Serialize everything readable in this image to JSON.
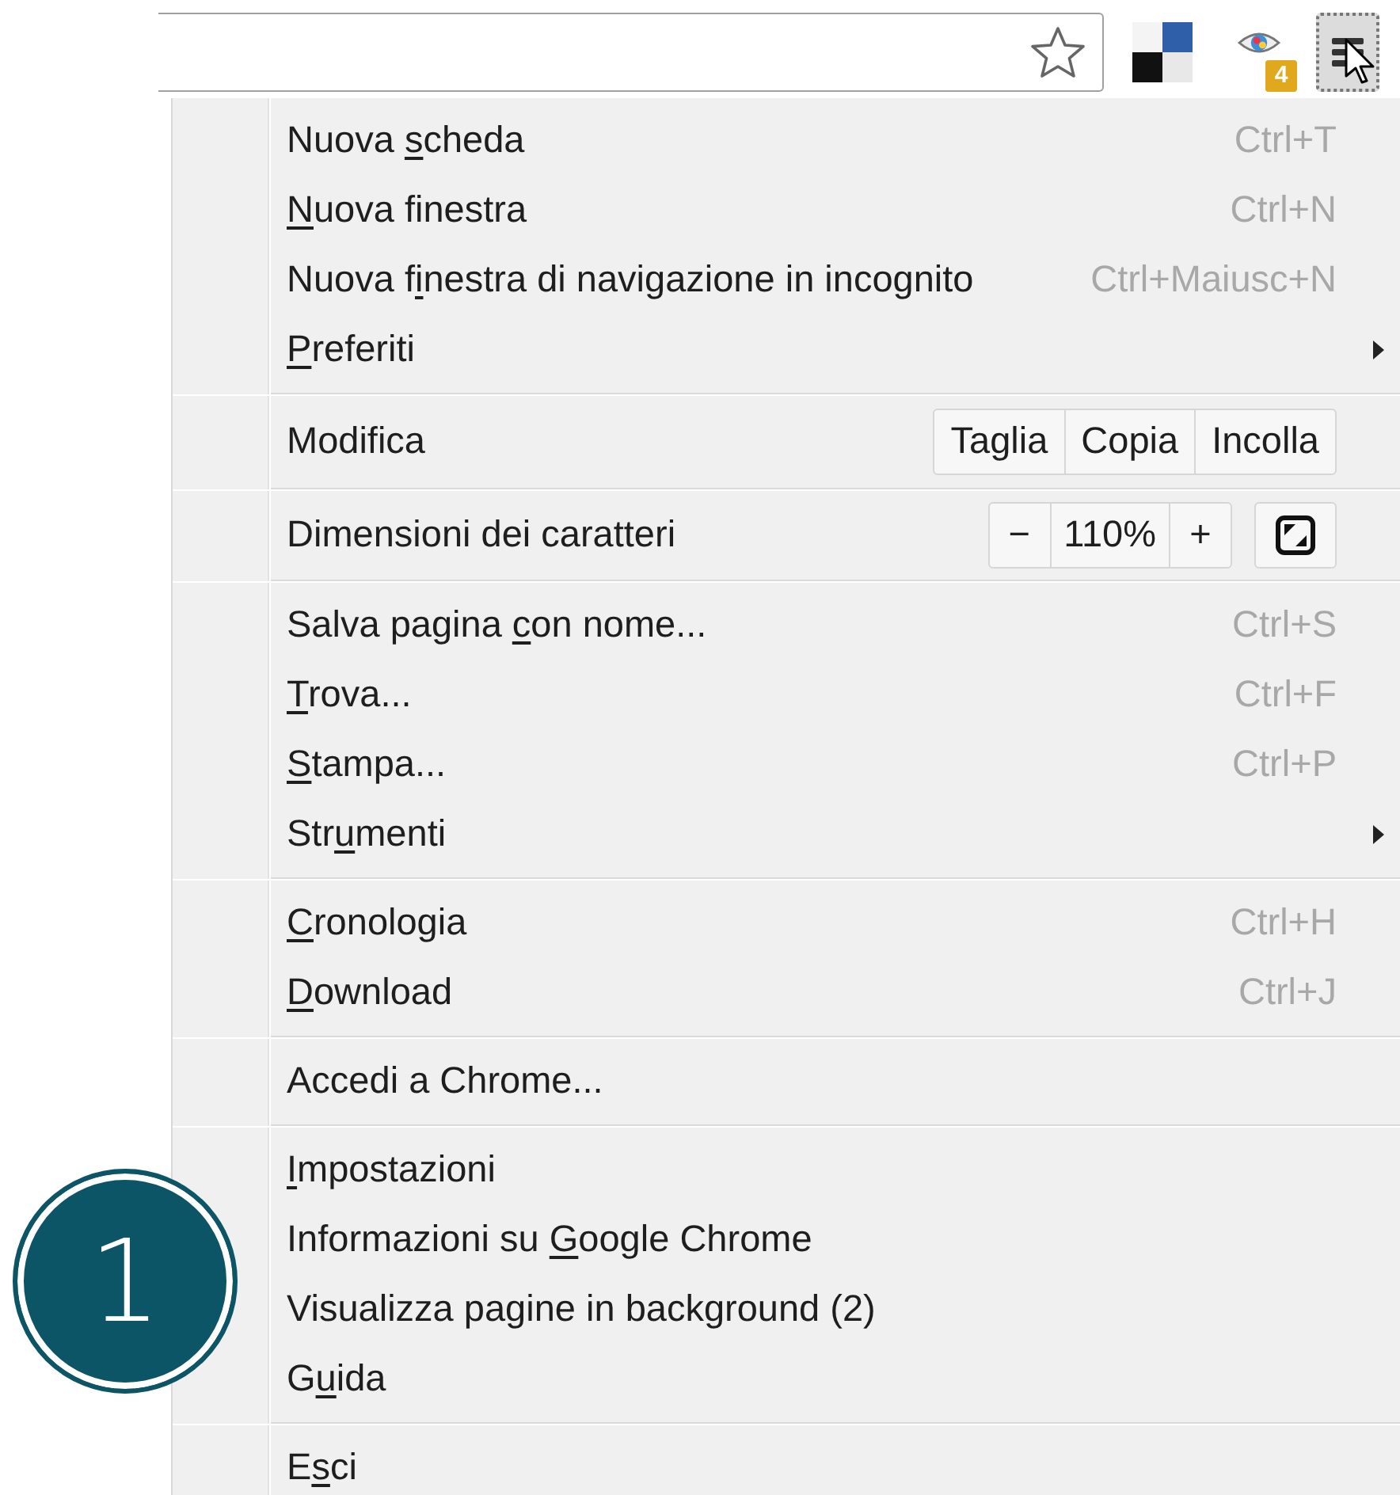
{
  "toolbar": {
    "extension_badge": "4"
  },
  "menu": {
    "sections": [
      {
        "items": [
          {
            "kind": "command",
            "label_parts": [
              {
                "text": "Nuova ",
                "underlined": false
              },
              {
                "text": "s",
                "underlined": true
              },
              {
                "text": "cheda",
                "underlined": false
              }
            ],
            "shortcut": "Ctrl+T"
          },
          {
            "kind": "command",
            "label_parts": [
              {
                "text": "N",
                "underlined": true
              },
              {
                "text": "uova finestra",
                "underlined": false
              }
            ],
            "shortcut": "Ctrl+N"
          },
          {
            "kind": "command",
            "label_parts": [
              {
                "text": "Nuova f",
                "underlined": false
              },
              {
                "text": "i",
                "underlined": true
              },
              {
                "text": "nestra di navigazione in incognito",
                "underlined": false
              }
            ],
            "shortcut": "Ctrl+Maiusc+N"
          },
          {
            "kind": "submenu",
            "label_parts": [
              {
                "text": "P",
                "underlined": true
              },
              {
                "text": "referiti",
                "underlined": false
              }
            ]
          }
        ]
      },
      {
        "items": [
          {
            "kind": "edit",
            "label_parts": [
              {
                "text": "Modifica",
                "underlined": false
              }
            ],
            "buttons": [
              "Taglia",
              "Copia",
              "Incolla"
            ]
          }
        ]
      },
      {
        "items": [
          {
            "kind": "zoom",
            "label_parts": [
              {
                "text": "Dimensioni dei caratteri",
                "underlined": false
              }
            ],
            "minus": "−",
            "value": "110%",
            "plus": "+"
          }
        ]
      },
      {
        "items": [
          {
            "kind": "command",
            "label_parts": [
              {
                "text": "Salva pagina ",
                "underlined": false
              },
              {
                "text": "c",
                "underlined": true
              },
              {
                "text": "on nome...",
                "underlined": false
              }
            ],
            "shortcut": "Ctrl+S"
          },
          {
            "kind": "command",
            "label_parts": [
              {
                "text": "T",
                "underlined": true
              },
              {
                "text": "rova...",
                "underlined": false
              }
            ],
            "shortcut": "Ctrl+F"
          },
          {
            "kind": "command",
            "label_parts": [
              {
                "text": "S",
                "underlined": true
              },
              {
                "text": "tampa...",
                "underlined": false
              }
            ],
            "shortcut": "Ctrl+P"
          },
          {
            "kind": "submenu",
            "label_parts": [
              {
                "text": "Str",
                "underlined": false
              },
              {
                "text": "u",
                "underlined": true
              },
              {
                "text": "menti",
                "underlined": false
              }
            ]
          }
        ]
      },
      {
        "items": [
          {
            "kind": "command",
            "label_parts": [
              {
                "text": "C",
                "underlined": true
              },
              {
                "text": "ronologia",
                "underlined": false
              }
            ],
            "shortcut": "Ctrl+H"
          },
          {
            "kind": "command",
            "label_parts": [
              {
                "text": "D",
                "underlined": true
              },
              {
                "text": "ownload",
                "underlined": false
              }
            ],
            "shortcut": "Ctrl+J"
          }
        ]
      },
      {
        "items": [
          {
            "kind": "command",
            "label_parts": [
              {
                "text": "Accedi a Chrome...",
                "underlined": false
              }
            ]
          }
        ]
      },
      {
        "items": [
          {
            "kind": "command",
            "label_parts": [
              {
                "text": "I",
                "underlined": true
              },
              {
                "text": "mpostazioni",
                "underlined": false
              }
            ]
          },
          {
            "kind": "command",
            "label_parts": [
              {
                "text": "Informazioni su ",
                "underlined": false
              },
              {
                "text": "G",
                "underlined": true
              },
              {
                "text": "oogle Chrome",
                "underlined": false
              }
            ]
          },
          {
            "kind": "command",
            "label_parts": [
              {
                "text": "Visualizza pagine in background (2)",
                "underlined": false
              }
            ]
          },
          {
            "kind": "command",
            "label_parts": [
              {
                "text": "G",
                "underlined": false
              },
              {
                "text": "u",
                "underlined": true
              },
              {
                "text": "ida",
                "underlined": false
              }
            ]
          }
        ]
      },
      {
        "items": [
          {
            "kind": "command",
            "label_parts": [
              {
                "text": "E",
                "underlined": false
              },
              {
                "text": "s",
                "underlined": true
              },
              {
                "text": "ci",
                "underlined": false
              }
            ]
          }
        ]
      }
    ]
  },
  "step_marker": {
    "number": "1"
  }
}
